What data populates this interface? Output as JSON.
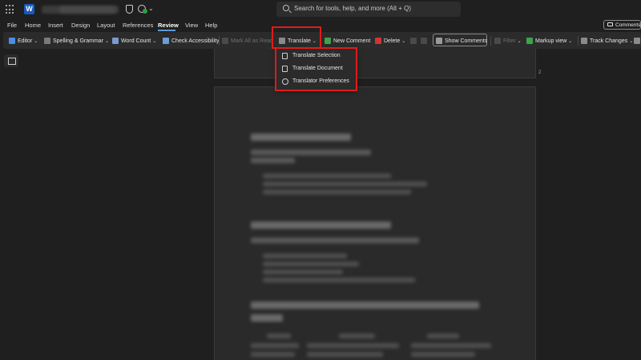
{
  "titlebar": {
    "app_logo_letter": "W",
    "search_placeholder": "Search for tools, help, and more (Alt + Q)"
  },
  "menu_tabs": [
    {
      "label": "File"
    },
    {
      "label": "Home"
    },
    {
      "label": "Insert"
    },
    {
      "label": "Design"
    },
    {
      "label": "Layout"
    },
    {
      "label": "References"
    },
    {
      "label": "Review",
      "active": true
    },
    {
      "label": "View"
    },
    {
      "label": "Help"
    }
  ],
  "comments_button": "Comments",
  "ribbon": {
    "editor": "Editor",
    "spelling": "Spelling & Grammar",
    "word_count": "Word Count",
    "accessibility": "Check Accessibility",
    "mark_read": "Mark All as Read",
    "translate": "Translate",
    "new_comment": "New Comment",
    "delete": "Delete",
    "show_comments": "Show Comments",
    "filter": "Filter",
    "markup_view": "Markup view",
    "track_changes": "Track Changes"
  },
  "translate_menu": {
    "items": [
      {
        "label": "Translate Selection"
      },
      {
        "label": "Translate Document"
      },
      {
        "label": "Translator Preferences"
      }
    ]
  },
  "document": {
    "page_number": "2"
  },
  "colors": {
    "highlight": "#e01b1b",
    "word_blue": "#185abd",
    "accent": "#5b9bd5"
  }
}
